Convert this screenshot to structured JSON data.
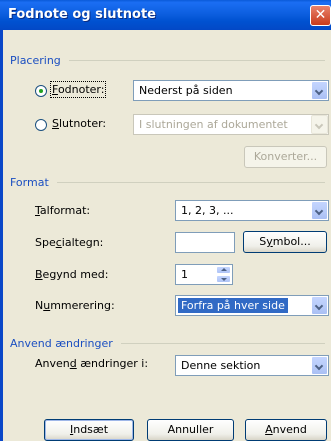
{
  "dialog": {
    "title": "Fodnote og slutnote"
  },
  "placement": {
    "heading": "Placering",
    "footnotes": {
      "label_accel": "F",
      "label_rest": "odnoter:",
      "value": "Nederst på siden",
      "selected": true
    },
    "endnotes": {
      "label_accel": "S",
      "label_rest": "lutnoter:",
      "value": "I slutningen af dokumentet",
      "selected": false
    },
    "convert_label": "Konverter..."
  },
  "format": {
    "heading": "Format",
    "number_format": {
      "label_accel": "T",
      "label_rest": "alformat:",
      "value": "1, 2, 3, ..."
    },
    "custom_mark": {
      "label_pre": "Spe",
      "label_accel": "c",
      "label_rest": "ialtegn:",
      "value": ""
    },
    "symbol_label_accel": "y",
    "symbol_label_pre": "S",
    "symbol_label_rest": "mbol...",
    "start_at": {
      "label_accel": "B",
      "label_rest": "egynd med:",
      "value": "1"
    },
    "numbering": {
      "label_pre": "N",
      "label_accel": "u",
      "label_rest": "mmerering:",
      "value": "Forfra på hver side"
    }
  },
  "apply": {
    "heading": "Anvend ændringer",
    "apply_to": {
      "label_pre": "Anven",
      "label_accel": "d",
      "label_rest": " ændringer i:",
      "value": "Denne sektion"
    }
  },
  "buttons": {
    "insert": {
      "accel": "I",
      "rest": "ndsæt"
    },
    "cancel": {
      "label": "Annuller"
    },
    "apply": {
      "accel": "A",
      "rest": "nvend"
    }
  }
}
